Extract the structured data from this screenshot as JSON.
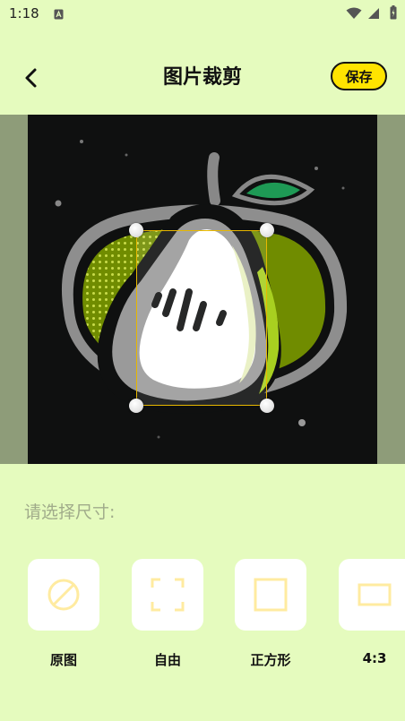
{
  "status_bar": {
    "time": "1:18",
    "notification_icon": "app-notification-icon",
    "wifi_icon": "wifi-icon",
    "signal_icon": "cell-signal-icon",
    "battery_icon": "battery-icon"
  },
  "header": {
    "back_icon": "chevron-left-icon",
    "title": "图片裁剪",
    "save_label": "保存"
  },
  "colors": {
    "background": "#E5FBBE",
    "accent": "#FFE400",
    "crop_border": "#E8B800",
    "ratio_icon_stroke": "#FFEBA0",
    "hint_text": "#A0AB8A",
    "crop_backdrop": "#8E9C79"
  },
  "crop": {
    "image_description_icon": "pear-logo-image"
  },
  "size_panel": {
    "prompt": "请选择尺寸:",
    "options": [
      {
        "label": "原图",
        "icon": "no-ratio-icon"
      },
      {
        "label": "自由",
        "icon": "free-crop-icon"
      },
      {
        "label": "正方形",
        "icon": "square-icon"
      },
      {
        "label": "4:3",
        "icon": "rectangle-4-3-icon"
      }
    ]
  }
}
